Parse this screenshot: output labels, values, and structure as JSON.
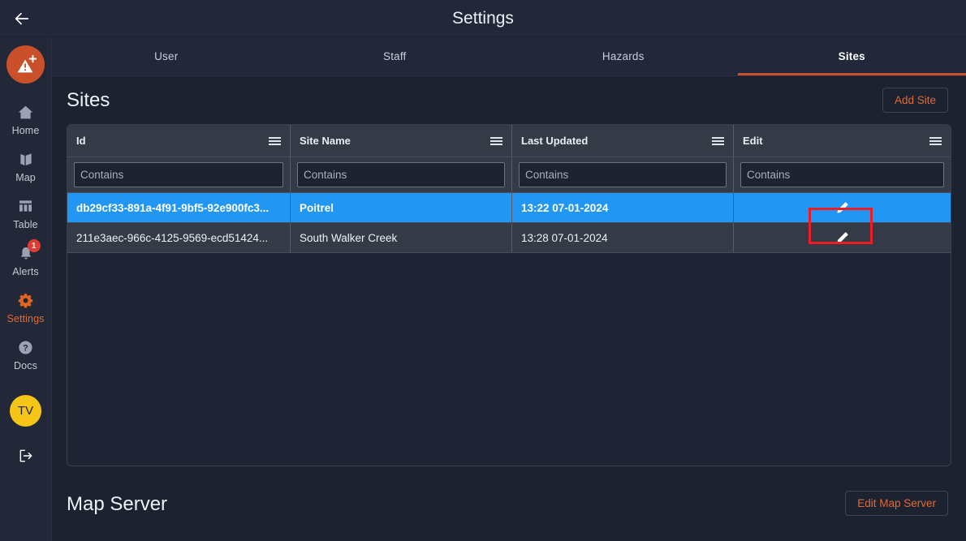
{
  "topbar": {
    "back_icon": "arrow-left-icon",
    "title": "Settings"
  },
  "sidebar": {
    "logo_icon": "warning-triangle-plus-icon",
    "items": [
      {
        "label": "Home",
        "icon": "home-icon",
        "active": false
      },
      {
        "label": "Map",
        "icon": "map-icon",
        "active": false
      },
      {
        "label": "Table",
        "icon": "table-icon",
        "active": false
      },
      {
        "label": "Alerts",
        "icon": "bell-icon",
        "active": false,
        "badge": "1"
      },
      {
        "label": "Settings",
        "icon": "gear-icon",
        "active": true
      },
      {
        "label": "Docs",
        "icon": "help-circle-icon",
        "active": false
      }
    ],
    "avatar_initials": "TV",
    "logout_icon": "logout-icon"
  },
  "tabs": [
    {
      "label": "User",
      "active": false
    },
    {
      "label": "Staff",
      "active": false
    },
    {
      "label": "Hazards",
      "active": false
    },
    {
      "label": "Sites",
      "active": true
    }
  ],
  "sites_section": {
    "title": "Sites",
    "add_button": "Add Site",
    "columns": [
      {
        "header": "Id",
        "menu_icon": "hamburger-menu-icon",
        "filter_placeholder": "Contains"
      },
      {
        "header": "Site Name",
        "menu_icon": "hamburger-menu-icon",
        "filter_placeholder": "Contains"
      },
      {
        "header": "Last Updated",
        "menu_icon": "hamburger-menu-icon",
        "filter_placeholder": "Contains"
      },
      {
        "header": "Edit",
        "menu_icon": "hamburger-menu-icon",
        "filter_placeholder": "Contains"
      }
    ],
    "filter_values": [
      "",
      "",
      "",
      ""
    ],
    "rows": [
      {
        "id": "db29cf33-891a-4f91-9bf5-92e900fc3...",
        "site_name": "Poitrel",
        "last_updated": "13:22  07-01-2024",
        "edit_icon": "pencil-icon",
        "selected": true
      },
      {
        "id": "211e3aec-966c-4125-9569-ecd51424...",
        "site_name": "South Walker Creek",
        "last_updated": "13:28  07-01-2024",
        "edit_icon": "pencil-icon",
        "selected": false
      }
    ]
  },
  "map_server_section": {
    "title": "Map Server",
    "edit_button": "Edit Map Server"
  },
  "colors": {
    "accent_orange": "#e06a33",
    "logo_orange": "#c9502a",
    "selected_row_blue": "#2196f3",
    "alert_red": "#e03c31",
    "annotation_red": "#ee1c25",
    "avatar_yellow": "#f5c518",
    "page_bg": "#1c2230",
    "panel_bg": "#22283a",
    "grid_header_bg": "#343a46"
  }
}
